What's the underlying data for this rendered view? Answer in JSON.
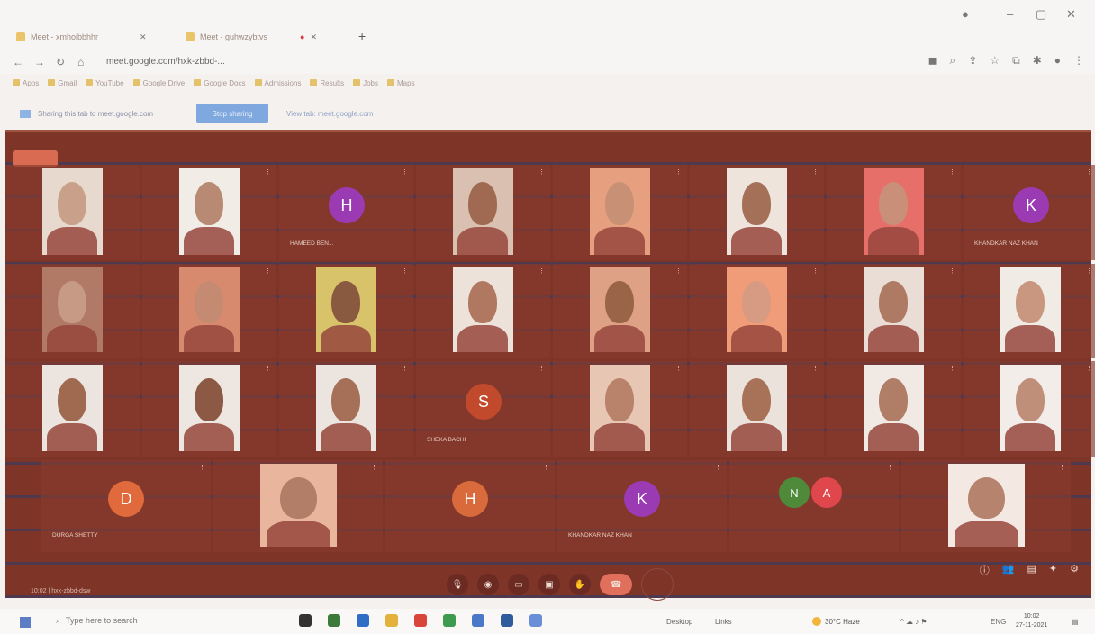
{
  "browser": {
    "tabs": [
      {
        "label": "Meet - xmhoibbhhr"
      },
      {
        "label": "Meet - guhwzybtvs"
      }
    ],
    "url": "meet.google.com/hxk-zbbd-...",
    "bookmarks": [
      "Apps",
      "Gmail",
      "YouTube",
      "Google Drive",
      "Google Docs",
      "Admissions",
      "Results",
      "Jobs",
      "Maps"
    ]
  },
  "sharebar": {
    "text": "Sharing this tab to meet.google.com",
    "stop_label": "Stop sharing",
    "hide_label": "View tab: meet.google.com"
  },
  "tiles": [
    {
      "name": "",
      "kind": "video",
      "skin": "#c9a089",
      "bg": "#e8d9cf"
    },
    {
      "name": "",
      "kind": "video",
      "skin": "#b98a73",
      "bg": "#f2ece6"
    },
    {
      "name": "HAMEED BEN...",
      "kind": "avatar",
      "letter": "H",
      "color": "#9b3bb4"
    },
    {
      "name": "",
      "kind": "video",
      "skin": "#a06a52",
      "bg": "#d9c0b1"
    },
    {
      "name": "",
      "kind": "video",
      "skin": "#c89074",
      "bg": "#e6a07f"
    },
    {
      "name": "",
      "kind": "video",
      "skin": "#a47058",
      "bg": "#efe4dc"
    },
    {
      "name": "",
      "kind": "video",
      "skin": "#c98f79",
      "bg": "#e66f6a"
    },
    {
      "name": "KHANDKAR NAZ KHAN",
      "kind": "avatar",
      "letter": "K",
      "color": "#9b3bb4"
    },
    {
      "name": "",
      "kind": "video",
      "skin": "#c79a86",
      "bg": "#b07a66"
    },
    {
      "name": "",
      "kind": "video",
      "skin": "#c58a72",
      "bg": "#d88a6f"
    },
    {
      "name": "",
      "kind": "video",
      "skin": "#8a5a40",
      "bg": "#d8c26a"
    },
    {
      "name": "",
      "kind": "video",
      "skin": "#b07860",
      "bg": "#ede2da"
    },
    {
      "name": "",
      "kind": "video",
      "skin": "#9a6448",
      "bg": "#dfa185"
    },
    {
      "name": "",
      "kind": "video",
      "skin": "#d79a83",
      "bg": "#f09c79"
    },
    {
      "name": "",
      "kind": "video",
      "skin": "#ae7a63",
      "bg": "#e9ddd6"
    },
    {
      "name": "",
      "kind": "video",
      "skin": "#c9967f",
      "bg": "#f1ebe6"
    },
    {
      "name": "",
      "kind": "video",
      "skin": "#a06a50",
      "bg": "#ece4de"
    },
    {
      "name": "",
      "kind": "video",
      "skin": "#8c5a44",
      "bg": "#eee6e0"
    },
    {
      "name": "",
      "kind": "video",
      "skin": "#a67058",
      "bg": "#ece5df"
    },
    {
      "name": "SHEKA BACHI",
      "kind": "avatar",
      "letter": "S",
      "color": "#c1492c"
    },
    {
      "name": "",
      "kind": "video",
      "skin": "#b8826b",
      "bg": "#e7c6b3"
    },
    {
      "name": "",
      "kind": "video",
      "skin": "#a87259",
      "bg": "#ebe2db"
    },
    {
      "name": "",
      "kind": "video",
      "skin": "#b07d66",
      "bg": "#f0e9e4"
    },
    {
      "name": "",
      "kind": "video",
      "skin": "#bf8f7a",
      "bg": "#f2ede9"
    },
    {
      "name": "DURGA SHETTY",
      "kind": "avatar",
      "letter": "D",
      "color": "#e06a3b"
    },
    {
      "name": "",
      "kind": "video",
      "skin": "#b27e68",
      "bg": "#e9b69d"
    },
    {
      "name": "",
      "kind": "avatar",
      "letter": "H",
      "color": "#d86a3c"
    },
    {
      "name": "KHANDKAR NAZ KHAN",
      "kind": "avatar",
      "letter": "K",
      "color": "#9b3bb4"
    },
    {
      "name": "",
      "kind": "double",
      "letter": "N",
      "letter2": "A",
      "color": "#4f8a3a",
      "color2": "#e0474d"
    },
    {
      "name": "",
      "kind": "video",
      "skin": "#b6846e",
      "bg": "#f3e8e2"
    }
  ],
  "meeting": {
    "info": "10:02 | hxk-zbbd-dsw"
  },
  "controls": [
    "mic-icon",
    "camera-icon",
    "captions-icon",
    "present-icon",
    "raise-hand-icon",
    "more-icon",
    "end-call-icon"
  ],
  "taskbar": {
    "search": "Type here to search",
    "desktop": "Desktop",
    "links": "Links",
    "weather": "30°C Haze",
    "lang": "ENG",
    "time": "10:02",
    "date": "27-11-2021"
  }
}
